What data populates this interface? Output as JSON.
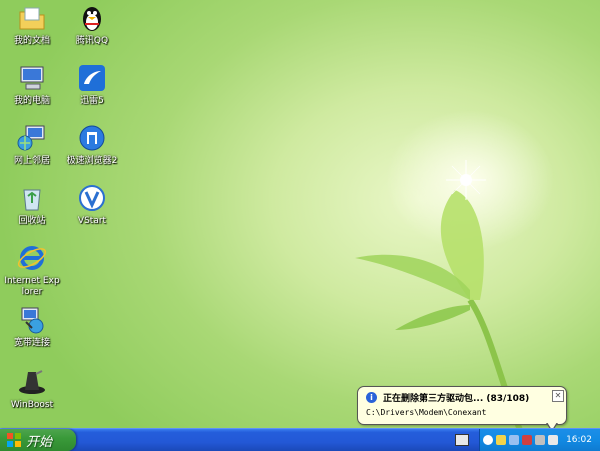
{
  "desktop": {
    "icons": [
      {
        "label": "我的文档",
        "icon": "my-documents-icon"
      },
      {
        "label": "腾讯QQ",
        "icon": "qq-penguin-icon"
      },
      {
        "label": "我的电脑",
        "icon": "my-computer-icon"
      },
      {
        "label": "迅雷5",
        "icon": "xunlei-icon"
      },
      {
        "label": "网上邻居",
        "icon": "network-places-icon"
      },
      {
        "label": "极速浏览器2",
        "icon": "browser-icon"
      },
      {
        "label": "回收站",
        "icon": "recycle-bin-icon"
      },
      {
        "label": "VStart",
        "icon": "vstart-icon"
      },
      {
        "label": "Internet Explorer",
        "icon": "internet-explorer-icon"
      },
      {
        "label": "宽带连接",
        "icon": "broadband-connection-icon"
      },
      {
        "label": "WinBoost",
        "icon": "winboost-hat-icon"
      }
    ]
  },
  "taskbar": {
    "start_label": "开始",
    "clock": "16:02"
  },
  "balloon": {
    "title": "正在删除第三方驱动包... (83/108)",
    "body": "C:\\Drivers\\Modem\\Conexant"
  },
  "colors": {
    "taskbar": "#245edb",
    "start_button": "#3a9a3a",
    "tray": "#128ae3",
    "balloon": "#ffffe1"
  }
}
